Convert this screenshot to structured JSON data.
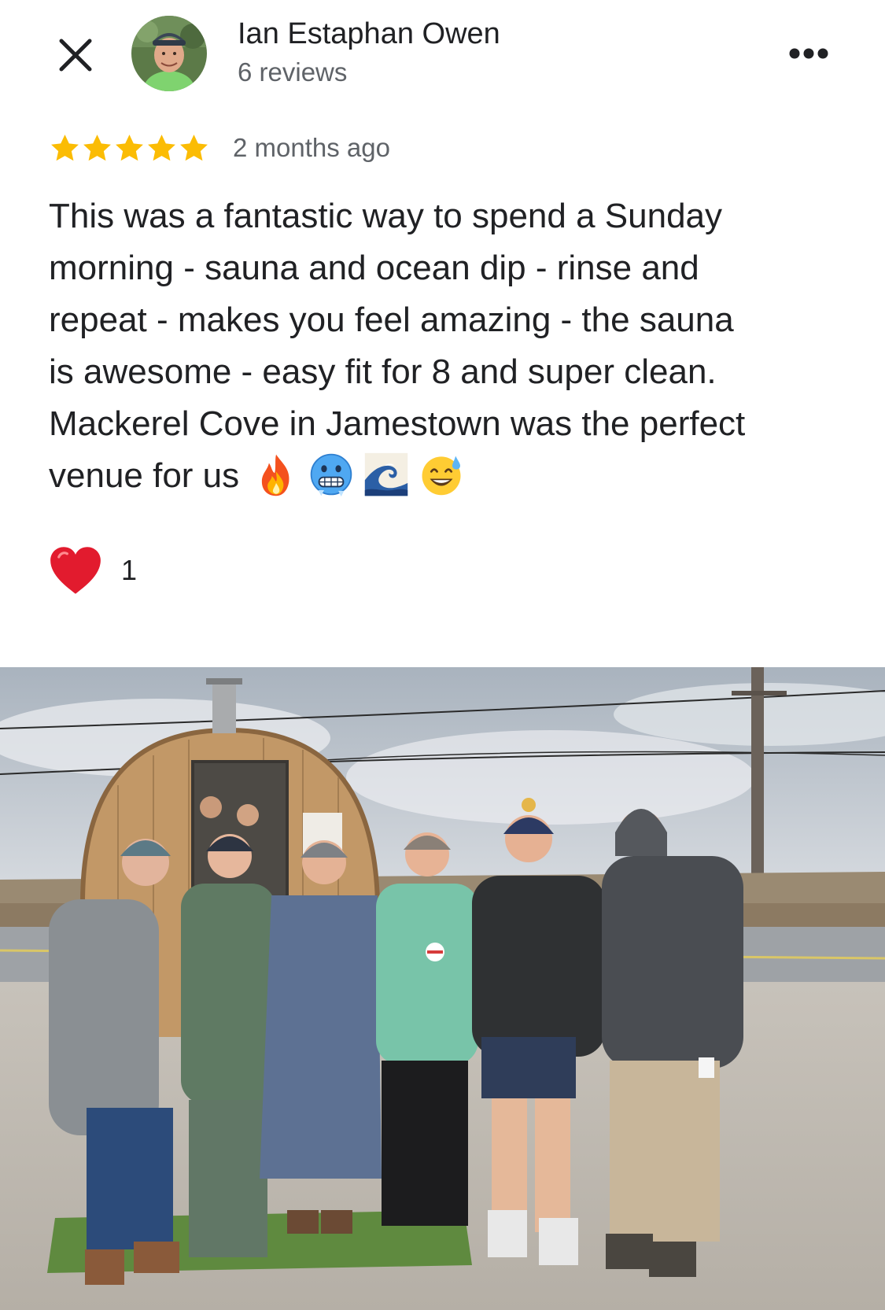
{
  "header": {
    "close_icon": "close-icon",
    "reviewer_name": "Ian Estaphan Owen",
    "review_count": "6 reviews",
    "more_icon": "more-horizontal-icon"
  },
  "review": {
    "rating": 5,
    "max_rating": 5,
    "star_color": "#FBBC04",
    "date": "2 months ago",
    "text_lines": [
      "This was a fantastic way to spend a Sunday",
      "morning - sauna and ocean dip - rinse and",
      "repeat - makes you feel amazing - the sauna",
      "is awesome - easy fit for 8  and super clean.",
      "Mackerel Cove in Jamestown was the perfect",
      "venue for us"
    ],
    "emojis": [
      "fire-emoji",
      "cold-face-emoji",
      "wave-emoji",
      "sweat-smile-emoji"
    ]
  },
  "reactions": {
    "heart_icon": "heart-icon",
    "heart_color": "#E21B2E",
    "count": "1"
  },
  "photo": {
    "subject": "group-photo"
  }
}
